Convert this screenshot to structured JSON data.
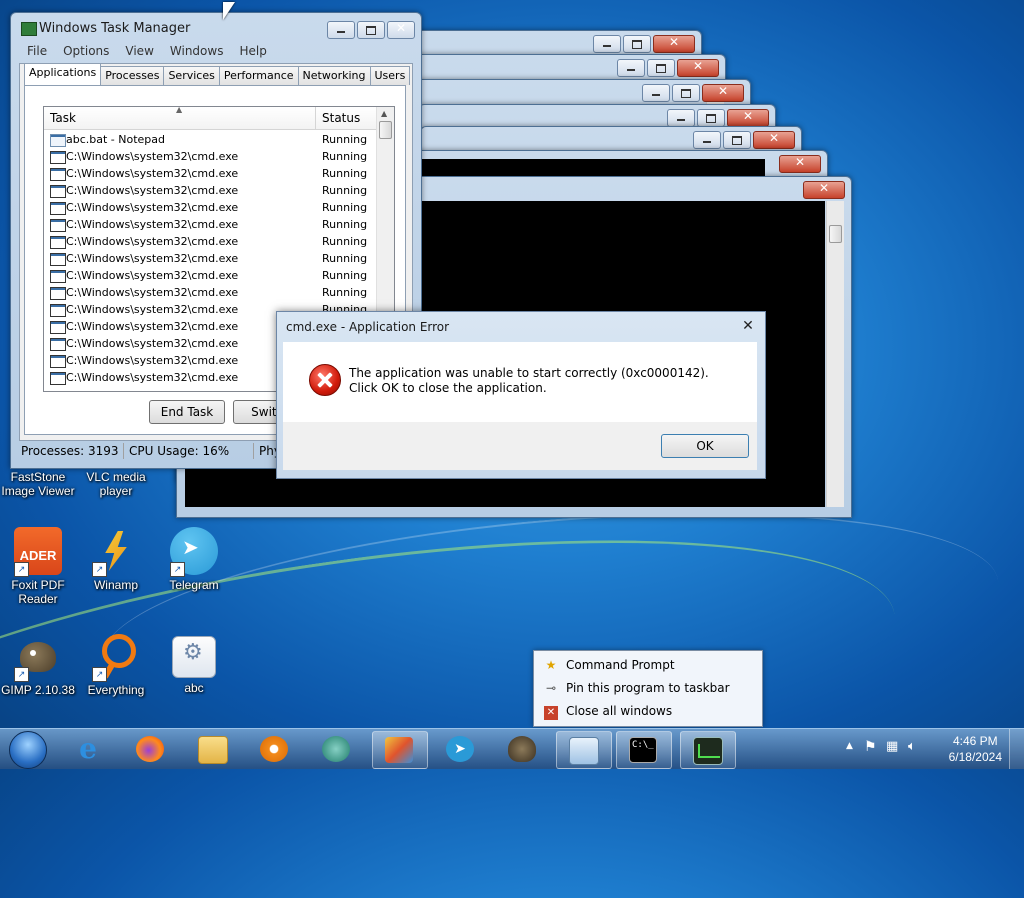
{
  "task_manager": {
    "title": "Windows Task Manager",
    "menu": [
      "File",
      "Options",
      "View",
      "Windows",
      "Help"
    ],
    "tabs": [
      "Applications",
      "Processes",
      "Services",
      "Performance",
      "Networking",
      "Users"
    ],
    "columns": {
      "task": "Task",
      "status": "Status"
    },
    "rows": [
      {
        "task": "abc.bat - Notepad",
        "status": "Running"
      },
      {
        "task": "C:\\Windows\\system32\\cmd.exe",
        "status": "Running"
      },
      {
        "task": "C:\\Windows\\system32\\cmd.exe",
        "status": "Running"
      },
      {
        "task": "C:\\Windows\\system32\\cmd.exe",
        "status": "Running"
      },
      {
        "task": "C:\\Windows\\system32\\cmd.exe",
        "status": "Running"
      },
      {
        "task": "C:\\Windows\\system32\\cmd.exe",
        "status": "Running"
      },
      {
        "task": "C:\\Windows\\system32\\cmd.exe",
        "status": "Running"
      },
      {
        "task": "C:\\Windows\\system32\\cmd.exe",
        "status": "Running"
      },
      {
        "task": "C:\\Windows\\system32\\cmd.exe",
        "status": "Running"
      },
      {
        "task": "C:\\Windows\\system32\\cmd.exe",
        "status": "Running"
      },
      {
        "task": "C:\\Windows\\system32\\cmd.exe",
        "status": "Running"
      },
      {
        "task": "C:\\Windows\\system32\\cmd.exe",
        "status": ""
      },
      {
        "task": "C:\\Windows\\system32\\cmd.exe",
        "status": ""
      },
      {
        "task": "C:\\Windows\\system32\\cmd.exe",
        "status": ""
      },
      {
        "task": "C:\\Windows\\system32\\cmd.exe",
        "status": ""
      }
    ],
    "end_task": "End Task",
    "switch_to": "Switch",
    "status": {
      "processes": "Processes: 3193",
      "cpu": "CPU Usage: 16%",
      "phys": "Phy"
    }
  },
  "error_dialog": {
    "title": "cmd.exe - Application Error",
    "message": "The application was unable to start correctly (0xc0000142). Click OK to close the application.",
    "ok": "OK",
    "close": "✕"
  },
  "desktop_icons": [
    {
      "label": "FastStone Image Viewer",
      "icon": "faststone-icon"
    },
    {
      "label": "VLC media player",
      "icon": "vlc-icon"
    },
    {
      "label": "Foxit PDF Reader",
      "icon": "foxit-icon"
    },
    {
      "label": "Winamp",
      "icon": "winamp-icon"
    },
    {
      "label": "Telegram",
      "icon": "telegram-icon"
    },
    {
      "label": "GIMP 2.10.38",
      "icon": "gimp-icon"
    },
    {
      "label": "Everything",
      "icon": "everything-icon"
    },
    {
      "label": "abc",
      "icon": "batch-file-icon"
    }
  ],
  "jumplist": {
    "items": [
      {
        "label": "Command Prompt",
        "icon": "star-icon"
      },
      {
        "label": "Pin this program to taskbar",
        "icon": "pin-icon"
      },
      {
        "label": "Close all windows",
        "icon": "close-window-icon"
      }
    ]
  },
  "taskbar": {
    "items": [
      "internet-explorer-icon",
      "firefox-icon",
      "file-explorer-icon",
      "media-player-icon",
      "video-player-icon",
      "paint-icon",
      "telegram-icon",
      "gimp-icon",
      "notepad-icon",
      "cmd-icon",
      "task-manager-icon"
    ],
    "time": "4:46 PM",
    "date": "6/18/2024"
  },
  "colors": {
    "close_red": "#c7422b",
    "error_red": "#d11b0b",
    "desktop_blue": "#1f7fd0"
  }
}
